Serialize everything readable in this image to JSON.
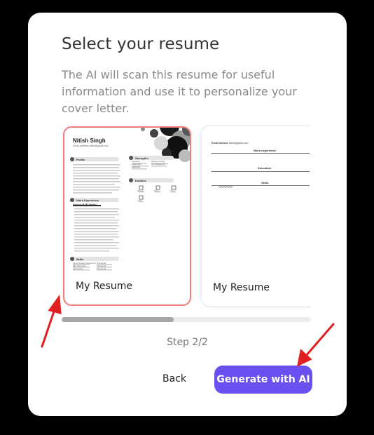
{
  "dialog": {
    "title": "Select your resume",
    "description": "The AI will scan this resume for useful information and use it to personalize your cover letter."
  },
  "resumes": [
    {
      "label": "My Resume",
      "selected": true,
      "preview": {
        "name": "Nitish Singh",
        "email_label": "Email address",
        "email": "nitish@gmail.com",
        "sections": [
          "Profile",
          "Strengths",
          "Hobbies",
          "Work Experience",
          "Skills"
        ],
        "job_title": "Senior B2B Writer",
        "strengths": [
          "Leadership",
          "Strategic Thinking",
          "Collaboration",
          "Time Management",
          "Adaptability"
        ],
        "hobbies": [
          "Reading",
          "Writing",
          "Travel",
          "Sport"
        ],
        "skills": [
          [
            "Content Strategy Development",
            "Professional"
          ],
          [
            "SEO Optimization",
            "Professional"
          ],
          [
            "Data Analysis",
            "Professional"
          ]
        ]
      }
    },
    {
      "label": "My Resume",
      "selected": false,
      "preview": {
        "email_label": "Email address",
        "email": "nitish@gmail.com",
        "sections": [
          "Work experience",
          "Education",
          "Skills"
        ]
      }
    }
  ],
  "progress": {
    "value": 0.45
  },
  "step_label": "Step 2/2",
  "actions": {
    "back": "Back",
    "generate": "Generate with AI"
  },
  "colors": {
    "accent": "#6b4ff0",
    "selected_border": "#f07a78",
    "annotation_arrow": "#e02020"
  }
}
